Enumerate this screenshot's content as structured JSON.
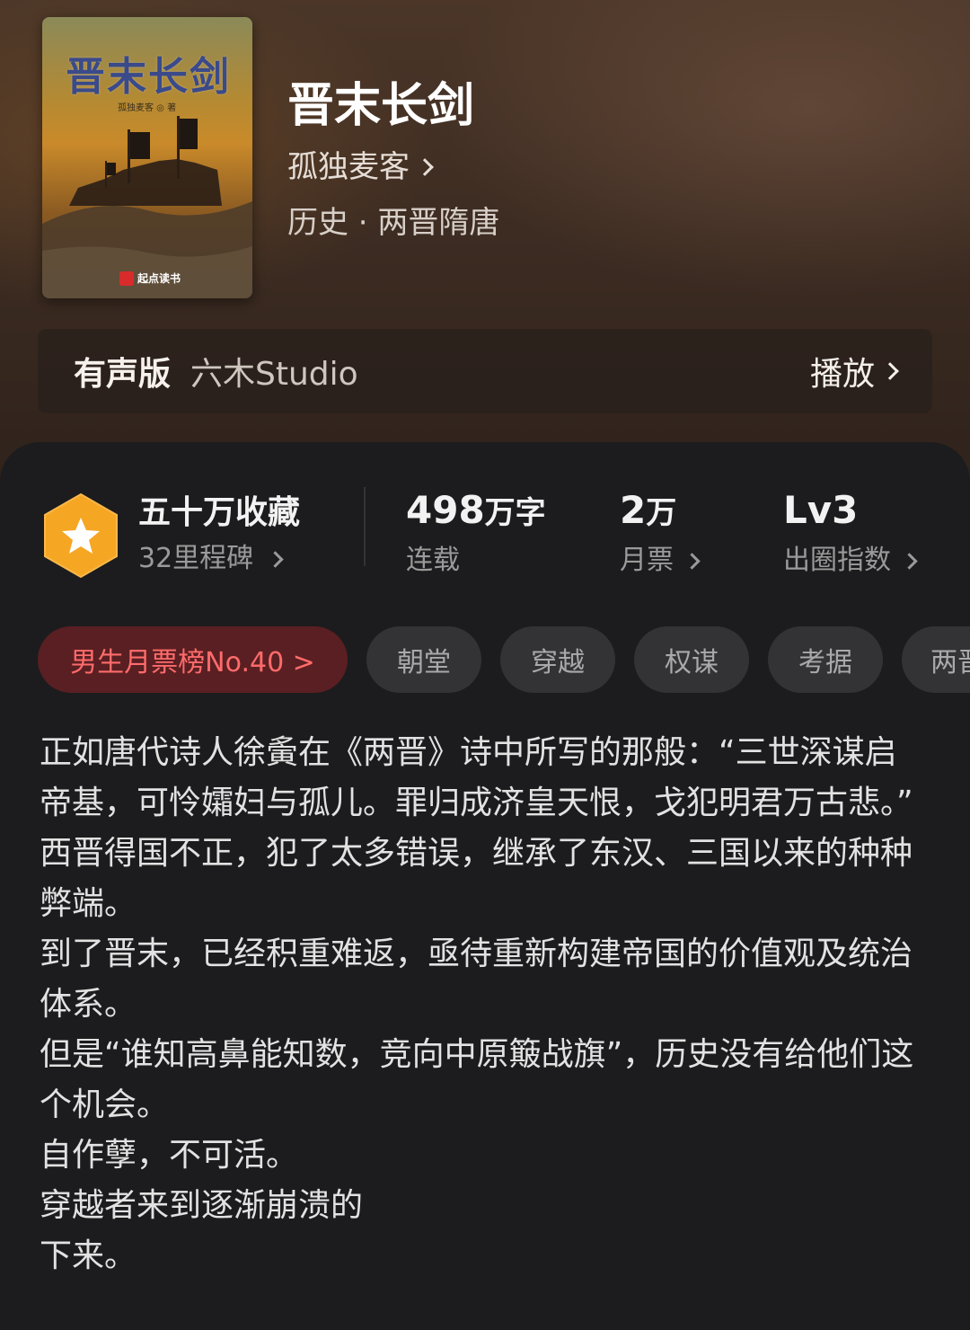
{
  "book": {
    "title": "晋末长剑",
    "author": "孤独麦客",
    "genre": "历史 · 两晋隋唐",
    "cover": {
      "title": "晋末长剑",
      "author_line": "孤独麦客 ◎ 著",
      "brand": "起点读书",
      "brand_color": "#d92b2b"
    }
  },
  "audio": {
    "label": "有声版",
    "studio": "六木Studio",
    "play_label": "播放"
  },
  "stats": {
    "collection": {
      "title": "五十万收藏",
      "sub": "32里程碑"
    },
    "words": {
      "value": "498",
      "unit": "万字",
      "label": "连载"
    },
    "monthly": {
      "value": "2",
      "unit": "万",
      "label": "月票"
    },
    "level": {
      "value": "Lv3",
      "label": "出圈指数"
    }
  },
  "tags": {
    "rank": "男生月票榜No.40 >",
    "items": [
      "朝堂",
      "穿越",
      "权谋",
      "考据",
      "两晋"
    ]
  },
  "description": [
    "正如唐代诗人徐夤在《两晋》诗中所写的那般：“三世深谋启帝基，可怜孀妇与孤儿。罪归成济皇天恨，戈犯明君万古悲。”",
    "西晋得国不正，犯了太多错误，继承了东汉、三国以来的种种弊端。",
    "到了晋末，已经积重难返，亟待重新构建帝国的价值观及统治体系。",
    "但是“谁知高鼻能知数，竞向中原簸战旗”，历史没有给他们这个机会。",
    "自作孽，不可活。",
    "穿越者来到逐渐崩溃的",
    "下来。"
  ],
  "colors": {
    "accent_red": "#ff6b6b",
    "badge_orange": "#f5a623",
    "panel_bg": "#1c1c1e"
  }
}
